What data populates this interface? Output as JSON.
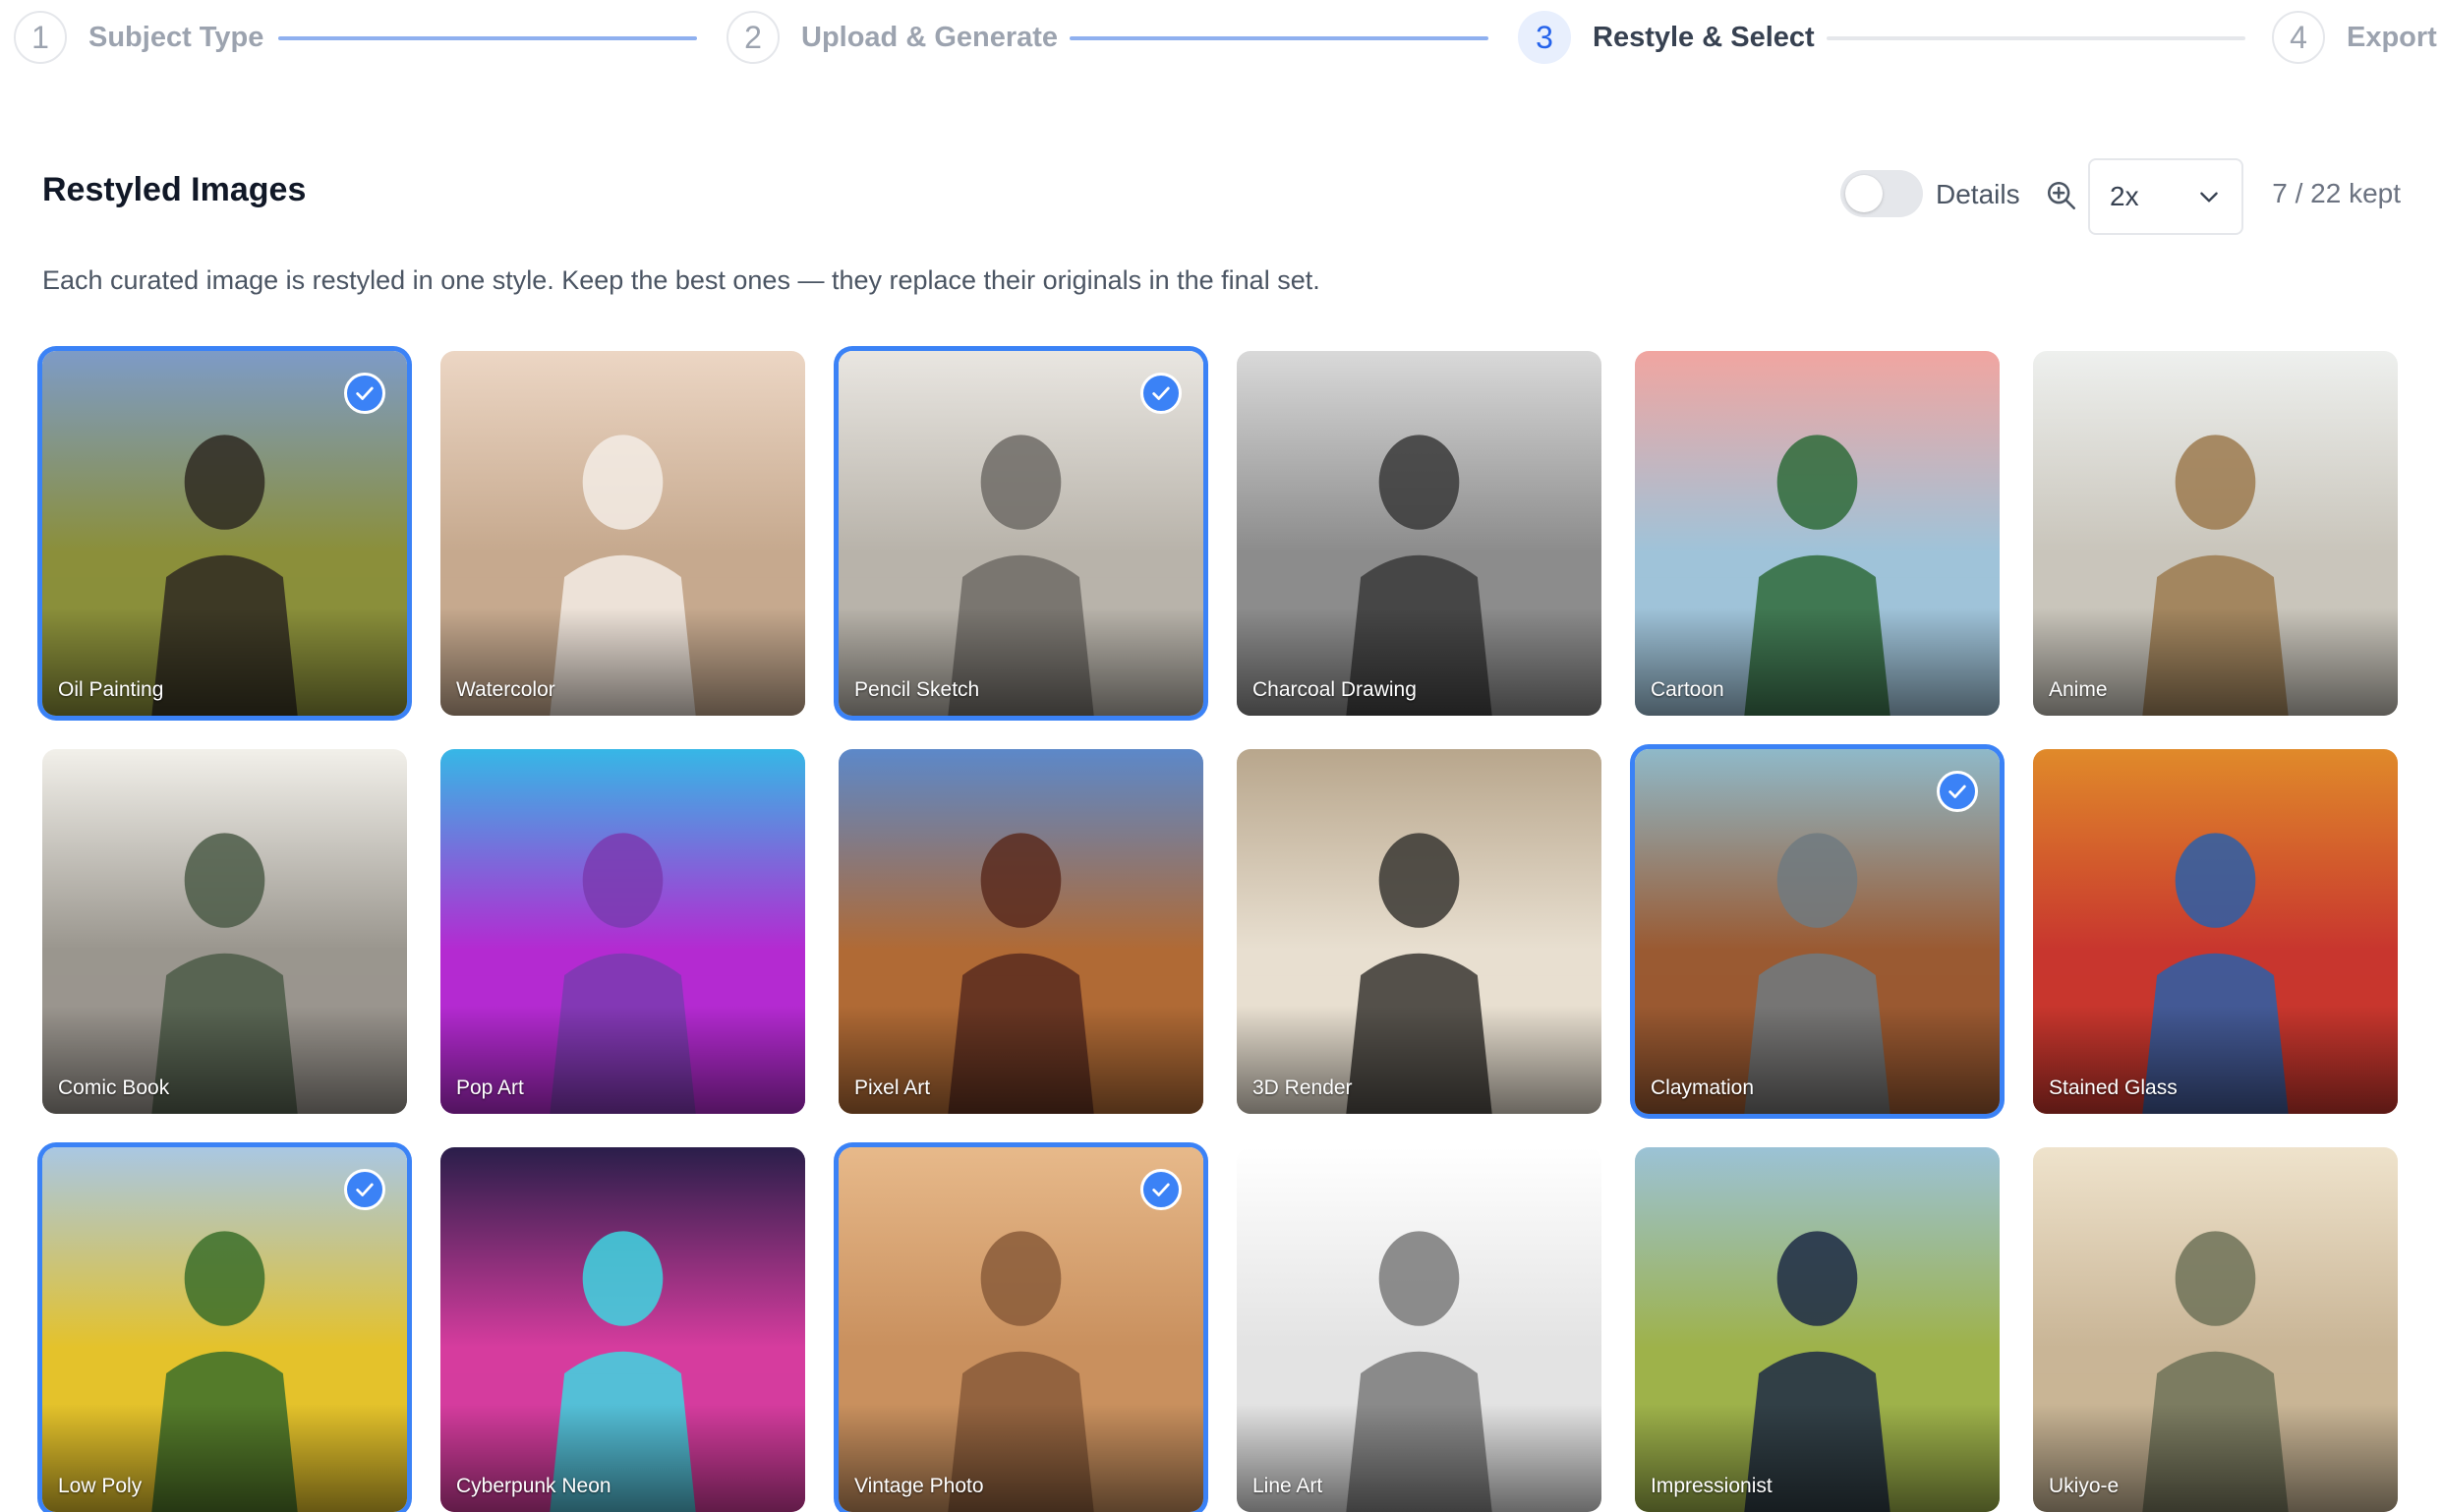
{
  "stepper": {
    "steps": [
      {
        "number": "1",
        "label": "Subject Type",
        "state": "done"
      },
      {
        "number": "2",
        "label": "Upload & Generate",
        "state": "done"
      },
      {
        "number": "3",
        "label": "Restyle & Select",
        "state": "active"
      },
      {
        "number": "4",
        "label": "Export",
        "state": "upcoming"
      }
    ]
  },
  "header": {
    "title": "Restyled Images",
    "details_label": "Details",
    "details_on": false,
    "zoom_value": "2x",
    "kept_count": "7 / 22 kept",
    "description": "Each curated image is restyled in one style. Keep the best ones — they replace their originals in the final set."
  },
  "colors": {
    "accent": "#3b82f6",
    "step_active_bg": "#e8effd",
    "line_done": "#8fb0ef"
  },
  "images": [
    {
      "label": "Oil Painting",
      "kept": true,
      "theme": [
        "#7d9bc7",
        "#8b8f3a",
        "#2f2a22"
      ]
    },
    {
      "label": "Watercolor",
      "kept": false,
      "theme": [
        "#ecd6c4",
        "#c6a98e",
        "#f3ece5"
      ]
    },
    {
      "label": "Pencil Sketch",
      "kept": true,
      "theme": [
        "#e9e6e1",
        "#b8b3aa",
        "#6f6b66"
      ]
    },
    {
      "label": "Charcoal Drawing",
      "kept": false,
      "theme": [
        "#d9d9d9",
        "#8c8c8c",
        "#3a3a3a"
      ]
    },
    {
      "label": "Cartoon",
      "kept": false,
      "theme": [
        "#f1a5a0",
        "#9fc3d9",
        "#2f6b3a"
      ]
    },
    {
      "label": "Anime",
      "kept": false,
      "theme": [
        "#eef0ee",
        "#c9c5bb",
        "#9c7a4f"
      ]
    },
    {
      "label": "Comic Book",
      "kept": false,
      "theme": [
        "#f2f0ea",
        "#9a968e",
        "#4c5c48"
      ]
    },
    {
      "label": "Pop Art",
      "kept": false,
      "theme": [
        "#36b7e6",
        "#b42ad1",
        "#7a3bb0"
      ]
    },
    {
      "label": "Pixel Art",
      "kept": false,
      "theme": [
        "#5c88c9",
        "#b06a35",
        "#5a2c1e"
      ]
    },
    {
      "label": "3D Render",
      "kept": false,
      "theme": [
        "#b8a68c",
        "#e8dfd0",
        "#3a3733"
      ]
    },
    {
      "label": "Claymation",
      "kept": true,
      "theme": [
        "#8fb9c9",
        "#9a5a32",
        "#707a80"
      ]
    },
    {
      "label": "Stained Glass",
      "kept": false,
      "theme": [
        "#e08a2a",
        "#c8362e",
        "#2b5fa8"
      ]
    },
    {
      "label": "Low Poly",
      "kept": true,
      "theme": [
        "#a9c7e3",
        "#e4c22b",
        "#3b6e2a"
      ]
    },
    {
      "label": "Cyberpunk Neon",
      "kept": false,
      "theme": [
        "#2a1e4a",
        "#d63c9e",
        "#3dd6e0"
      ]
    },
    {
      "label": "Vintage Photo",
      "kept": true,
      "theme": [
        "#e7b98a",
        "#c9905e",
        "#8a5c3a"
      ]
    },
    {
      "label": "Line Art",
      "kept": false,
      "theme": [
        "#ffffff",
        "#e3e3e3",
        "#7a7a7a"
      ]
    },
    {
      "label": "Impressionist",
      "kept": false,
      "theme": [
        "#9bc2d6",
        "#9eb24a",
        "#1d2a45"
      ]
    },
    {
      "label": "Ukiyo-e",
      "kept": false,
      "theme": [
        "#efe3cc",
        "#c9b596",
        "#6e7258"
      ]
    }
  ]
}
